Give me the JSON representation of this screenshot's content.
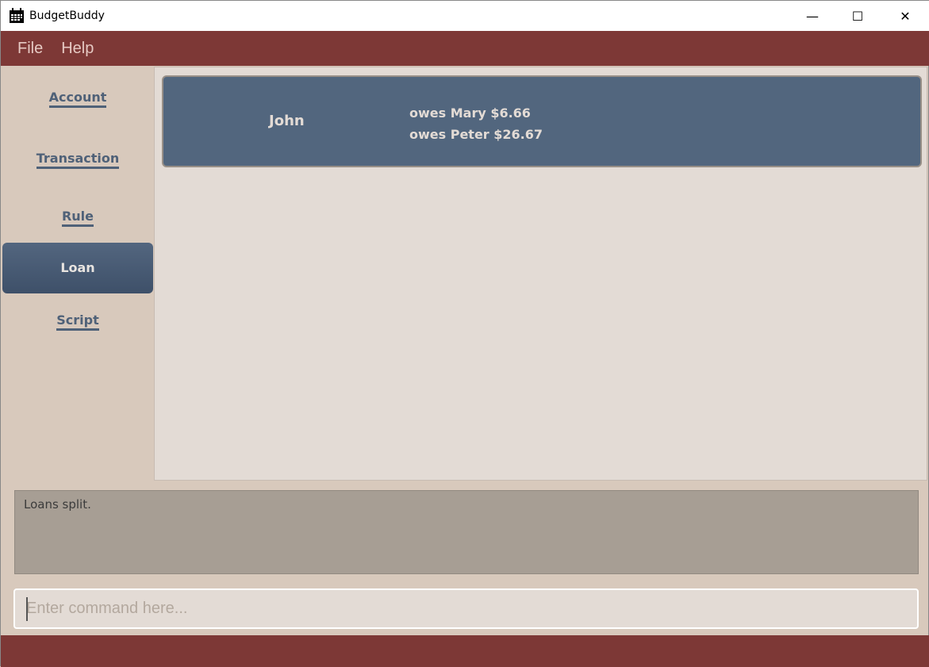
{
  "window": {
    "title": "BudgetBuddy",
    "icon": "calendar-icon"
  },
  "menu": [
    "File",
    "Help"
  ],
  "sidebar": {
    "items": [
      {
        "label": "Account"
      },
      {
        "label": "Transaction"
      },
      {
        "label": "Rule"
      },
      {
        "label": "Loan",
        "active": true
      },
      {
        "label": "Script"
      }
    ]
  },
  "loans": [
    {
      "name": "John",
      "debts": [
        "owes Mary $6.66",
        "owes Peter $26.67"
      ]
    }
  ],
  "result": "Loans split.",
  "command": {
    "placeholder": "Enter command here..."
  }
}
